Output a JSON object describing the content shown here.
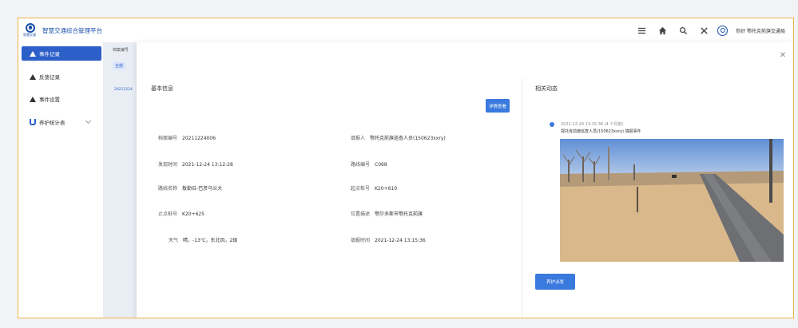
{
  "header": {
    "app_title": "智慧交通综合管理平台",
    "logo_sub": "智慧交通",
    "user_name": "你好 鄂托克前旗交通局"
  },
  "sidebar": {
    "items": [
      {
        "label": "事件记录",
        "icon": "warning-icon",
        "active": true
      },
      {
        "label": "反馈记录",
        "icon": "warning-icon",
        "active": false
      },
      {
        "label": "事件设置",
        "icon": "warning-icon",
        "active": false
      },
      {
        "label": "养护统计表",
        "icon": "stats-icon",
        "active": false
      }
    ]
  },
  "list_bg": {
    "column_header": "档案编号",
    "tag": "全部",
    "cell": "20211224"
  },
  "modal": {
    "basic_info_title": "基本信息",
    "view_button": "详情查看",
    "fields": [
      {
        "label": "档案编号",
        "value": "20211224006"
      },
      {
        "label": "填报人",
        "value": "鄂托克前旗巡查人员(150623xxry)"
      },
      {
        "label": "发现时间",
        "value": "2021-12-24 13:12:28"
      },
      {
        "label": "路线编号",
        "value": "C068"
      },
      {
        "label": "路线名称",
        "value": "敖勒召-巴彦乌兰大"
      },
      {
        "label": "起点桩号",
        "value": "K20+610"
      },
      {
        "label": "止点桩号",
        "value": "K20+625"
      },
      {
        "label": "位置描述",
        "value": "鄂尔多斯市鄂托克前旗"
      },
      {
        "label": "天气",
        "value": "晴，-13℃，东北风，2级"
      },
      {
        "label": "填报时间",
        "value": "2021-12-24 13:15:36"
      }
    ],
    "related_title": "相关动态",
    "timeline": {
      "time": "2021-12-24 13:15:36 (4 个月前)",
      "text": "鄂托克前旗巡查人员(150623xxry) 填报事件"
    },
    "dispatch_button": "养护派发"
  },
  "colors": {
    "primary": "#2d5fc9",
    "button": "#3a79de",
    "border": "#f0b24a"
  }
}
